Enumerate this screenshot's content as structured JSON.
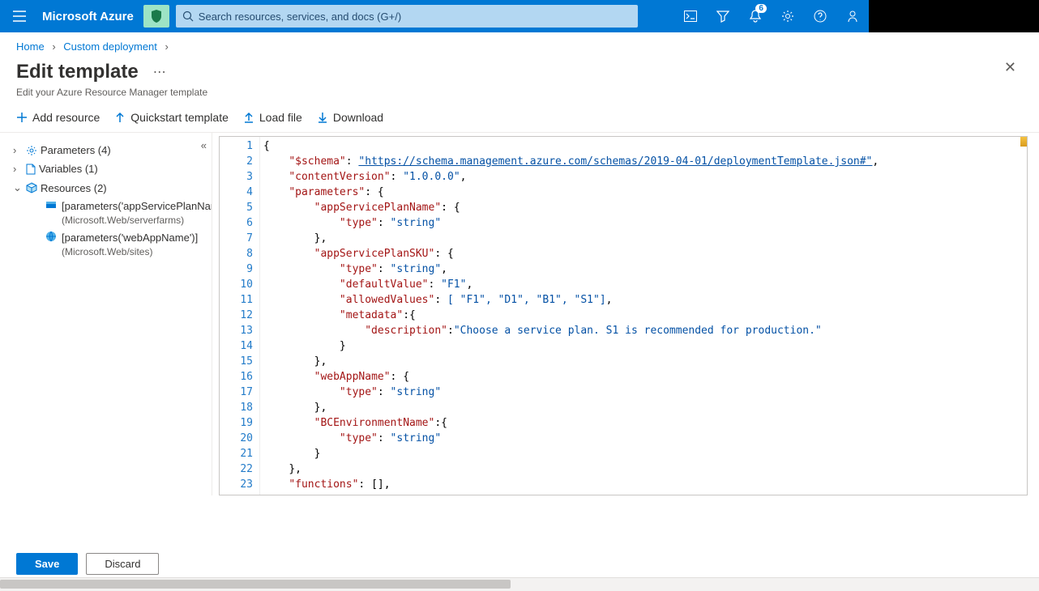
{
  "topbar": {
    "brand": "Microsoft Azure",
    "search_placeholder": "Search resources, services, and docs (G+/)",
    "notification_count": "6"
  },
  "breadcrumb": {
    "home": "Home",
    "custom": "Custom deployment"
  },
  "page": {
    "title": "Edit template",
    "subtitle": "Edit your Azure Resource Manager template"
  },
  "toolbar": {
    "add": "Add resource",
    "quickstart": "Quickstart template",
    "load": "Load file",
    "download": "Download"
  },
  "outline": {
    "parameters": "Parameters (4)",
    "variables": "Variables (1)",
    "resources": "Resources (2)",
    "res1_name": "[parameters('appServicePlanName",
    "res1_sub": "(Microsoft.Web/serverfarms)",
    "res2_name": "[parameters('webAppName')]",
    "res2_sub": "(Microsoft.Web/sites)"
  },
  "editor": {
    "lines": [
      "1",
      "2",
      "3",
      "4",
      "5",
      "6",
      "7",
      "8",
      "9",
      "10",
      "11",
      "12",
      "13",
      "14",
      "15",
      "16",
      "17",
      "18",
      "19",
      "20",
      "21",
      "22",
      "23"
    ],
    "json": {
      "schema_key": "\"$schema\"",
      "schema_val": "\"https://schema.management.azure.com/schemas/2019-04-01/deploymentTemplate.json#\"",
      "contentVersion_key": "\"contentVersion\"",
      "contentVersion_val": "\"1.0.0.0\"",
      "parameters_key": "\"parameters\"",
      "appServicePlanName_key": "\"appServicePlanName\"",
      "type_key": "\"type\"",
      "string_val": "\"string\"",
      "appServicePlanSKU_key": "\"appServicePlanSKU\"",
      "defaultValue_key": "\"defaultValue\"",
      "f1_val": "\"F1\"",
      "allowedValues_key": "\"allowedValues\"",
      "allowed_list": "[ \"F1\", \"D1\", \"B1\", \"S1\"]",
      "metadata_key": "\"metadata\"",
      "description_key": "\"description\"",
      "description_val": "\"Choose a service plan. S1 is recommended for production.\"",
      "webAppName_key": "\"webAppName\"",
      "BCEnvironmentName_key": "\"BCEnvironmentName\"",
      "functions_key": "\"functions\"",
      "functions_val": "[]"
    }
  },
  "footer": {
    "save": "Save",
    "discard": "Discard"
  }
}
